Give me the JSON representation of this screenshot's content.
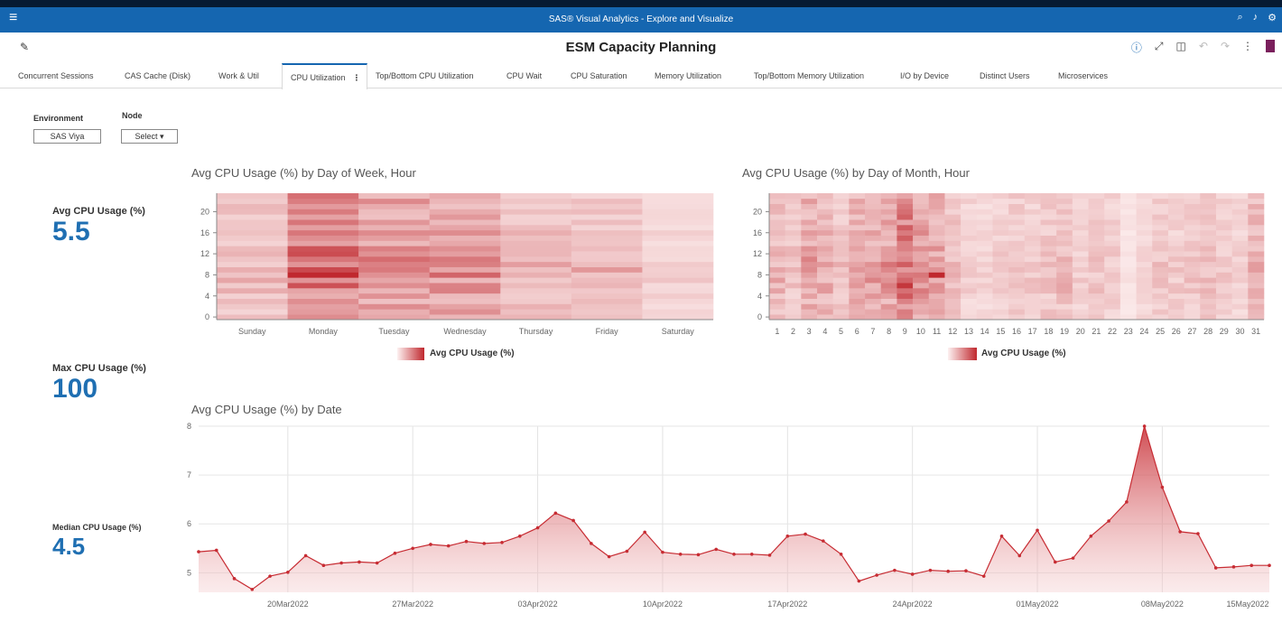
{
  "app": {
    "title": "SAS® Visual Analytics - Explore and Visualize",
    "report_title": "ESM Capacity Planning"
  },
  "tabs": [
    {
      "label": "Concurrent Sessions"
    },
    {
      "label": "CAS Cache (Disk)"
    },
    {
      "label": "Work & Util"
    },
    {
      "label": "CPU Utilization",
      "active": true
    },
    {
      "label": "Top/Bottom CPU Utilization"
    },
    {
      "label": "CPU Wait"
    },
    {
      "label": "CPU Saturation"
    },
    {
      "label": "Memory Utilization"
    },
    {
      "label": "Top/Bottom Memory Utilization"
    },
    {
      "label": "I/O by Device"
    },
    {
      "label": "Distinct Users"
    },
    {
      "label": "Microservices"
    }
  ],
  "controls": {
    "environment_label": "Environment",
    "environment_value": "SAS Viya",
    "node_label": "Node",
    "node_value": "Select",
    "node_arrow": "▾"
  },
  "kpis": {
    "avg_label": "Avg CPU Usage (%)",
    "avg_value": "5.5",
    "max_label": "Max CPU Usage (%)",
    "max_value": "100",
    "median_label": "Median CPU Usage (%)",
    "median_value": "4.5"
  },
  "icons": {
    "menu": "menu-icon",
    "search": "search-icon",
    "bell": "bell-icon",
    "settings": "settings-icon",
    "edit": "pencil-icon",
    "help": "help-icon",
    "expand": "expand-icon",
    "layout": "layout-icon",
    "undo": "undo-icon",
    "redo": "redo-icon",
    "more": "more-icon"
  },
  "colors": {
    "topbar": "#1566b0",
    "accent": "#1566b0",
    "kpi": "#1f6fb2",
    "heat_max": "#c0282e",
    "heat_min": "#fdf1f1",
    "line": "#c72c33"
  },
  "chart_data": [
    {
      "type": "heatmap",
      "title": "Avg CPU Usage (%) by Day of Week, Hour",
      "x": [
        "Sunday",
        "Monday",
        "Tuesday",
        "Wednesday",
        "Thursday",
        "Friday",
        "Saturday"
      ],
      "y_ticks": [
        0,
        4,
        8,
        12,
        16,
        20
      ],
      "y_range": [
        0,
        23
      ],
      "legend": "Avg CPU Usage (%)",
      "column_levels": [
        0.22,
        0.48,
        0.38,
        0.36,
        0.24,
        0.2,
        0.14
      ],
      "hot_cells": [
        {
          "x": "Monday",
          "hour": 8,
          "level": 1.0
        },
        {
          "x": "Wednesday",
          "hour": 8,
          "level": 0.7
        },
        {
          "x": "Wednesday",
          "hour": 11,
          "level": 0.6
        },
        {
          "x": "Friday",
          "hour": 9,
          "level": 0.45
        }
      ]
    },
    {
      "type": "heatmap",
      "title": "Avg CPU Usage (%) by Day of Month, Hour",
      "x": [
        "1",
        "2",
        "3",
        "4",
        "5",
        "6",
        "7",
        "8",
        "9",
        "10",
        "11",
        "12",
        "13",
        "14",
        "15",
        "16",
        "17",
        "18",
        "19",
        "20",
        "21",
        "22",
        "23",
        "24",
        "25",
        "26",
        "27",
        "28",
        "29",
        "30",
        "31"
      ],
      "y_ticks": [
        0,
        4,
        8,
        12,
        16,
        20
      ],
      "y_range": [
        0,
        23
      ],
      "legend": "Avg CPU Usage (%)",
      "column_levels": [
        0.25,
        0.18,
        0.32,
        0.28,
        0.2,
        0.3,
        0.34,
        0.36,
        0.55,
        0.4,
        0.3,
        0.22,
        0.14,
        0.12,
        0.14,
        0.18,
        0.16,
        0.2,
        0.22,
        0.14,
        0.18,
        0.16,
        0.06,
        0.12,
        0.18,
        0.16,
        0.18,
        0.2,
        0.16,
        0.14,
        0.26
      ],
      "hot_cells": [
        {
          "x": "11",
          "hour": 8,
          "level": 1.0
        },
        {
          "x": "9",
          "hour": 7,
          "level": 0.7
        },
        {
          "x": "9",
          "hour": 21,
          "level": 0.6
        }
      ]
    },
    {
      "type": "area",
      "title": "Avg CPU Usage (%) by Date",
      "x_tick_labels": [
        "20Mar2022",
        "27Mar2022",
        "03Apr2022",
        "10Apr2022",
        "17Apr2022",
        "24Apr2022",
        "01May2022",
        "08May2022",
        "15May2022"
      ],
      "x_range": [
        "15Mar2022",
        "16May2022"
      ],
      "ylim": [
        4.6,
        8.0
      ],
      "y_ticks": [
        5,
        6,
        7,
        8
      ],
      "grid": true,
      "series": [
        {
          "values": [
            5.43,
            5.46,
            4.88,
            4.66,
            4.93,
            5.01,
            5.35,
            5.15,
            5.2,
            5.22,
            5.2,
            5.4,
            5.5,
            5.58,
            5.55,
            5.64,
            5.6,
            5.62,
            5.75,
            5.92,
            6.22,
            6.07,
            5.6,
            5.33,
            5.44,
            5.83,
            5.42,
            5.38,
            5.37,
            5.48,
            5.38,
            5.38,
            5.36,
            5.75,
            5.79,
            5.65,
            5.38,
            4.83,
            4.95,
            5.05,
            4.97,
            5.05,
            5.03,
            5.04,
            4.93,
            5.75,
            5.35,
            5.87,
            5.22,
            5.3,
            5.75,
            6.06,
            6.45,
            8.0,
            6.75,
            5.84,
            5.8,
            5.1,
            5.12,
            5.15,
            5.15
          ]
        }
      ]
    }
  ]
}
